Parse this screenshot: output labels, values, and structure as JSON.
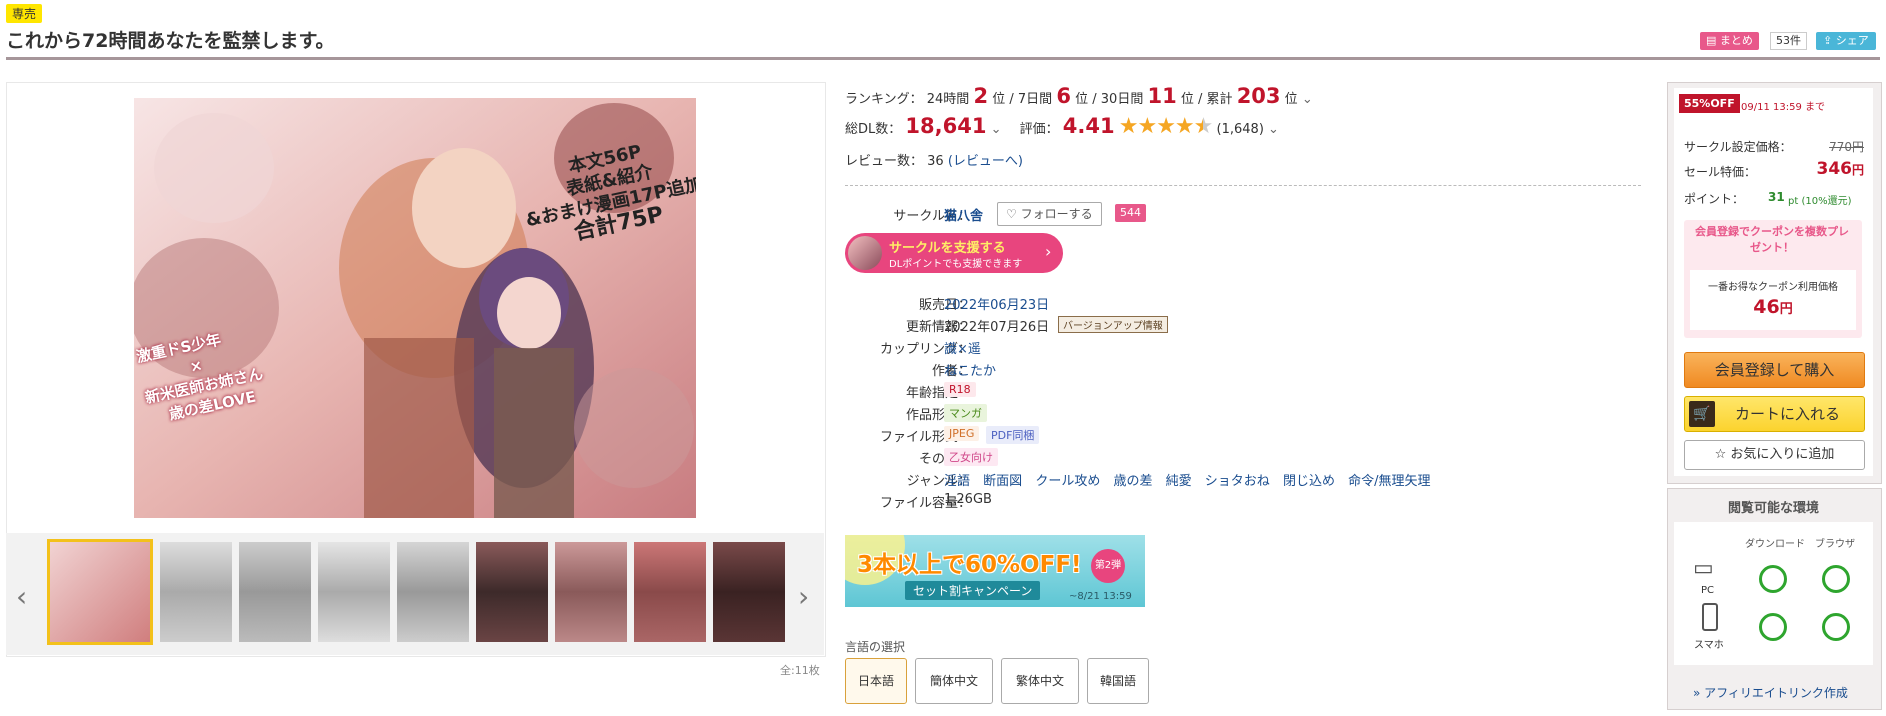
{
  "header": {
    "exclusive_label": "専売",
    "title": "これから72時間あなたを監禁します。",
    "matome_label": "まとめ",
    "matome_count": "53件",
    "share_label": "シェア"
  },
  "gallery": {
    "image_count": "全:11枚",
    "cover_caption_1": "本文56P",
    "cover_caption_2": "表紙&紹介",
    "cover_caption_3": "&おまけ漫画17P追加",
    "cover_caption_4": "合計75P",
    "cover_logo_text": "これから72時間あなたを監禁します。",
    "cover_tagline_1": "激重ドS少年",
    "cover_tagline_2": "×",
    "cover_tagline_3": "新米医師お姉さん",
    "cover_tagline_4": "歳の差LOVE"
  },
  "ranking": {
    "label": "ランキング：",
    "h24_label": "24時間",
    "h24_value": "2",
    "d7_label": "7日間",
    "d7_value": "6",
    "d30_label": "30日間",
    "d30_value": "11",
    "total_label": "累計",
    "total_value": "203",
    "unit": "位",
    "sep": "/"
  },
  "downloads": {
    "label": "総DL数：",
    "value": "18,641",
    "rating_label": "評価：",
    "rating_value": "4.41",
    "rating_stars": 4.41,
    "rating_count": "(1,648)"
  },
  "reviews": {
    "label": "レビュー数：",
    "value": "36",
    "link": "(レビューへ)"
  },
  "circle": {
    "label": "サークル名：",
    "name": "猫八舎",
    "follow_label": "フォローする",
    "follow_count": "544",
    "support_title": "サークルを支援する",
    "support_sub": "DLポイントでも支援できます"
  },
  "details": [
    {
      "label": "販売日：",
      "value": "2022年06月23日"
    },
    {
      "label": "更新情報：",
      "value": "2022年07月26日",
      "badge": "バージョンアップ情報"
    },
    {
      "label": "カップリング：",
      "value": "識×遥"
    },
    {
      "label": "作者：",
      "value": "ねこたか"
    },
    {
      "label": "年齢指定：",
      "value": "R18"
    },
    {
      "label": "作品形式：",
      "value": "マンガ"
    },
    {
      "label": "ファイル形式：",
      "value": "JPEG",
      "value2": "PDF同梱"
    },
    {
      "label": "その他：",
      "value": "乙女向け"
    },
    {
      "label": "ジャンル：",
      "genres": [
        "淫語",
        "断面図",
        "クール攻め",
        "歳の差",
        "純愛",
        "ショタおね",
        "閉じ込め",
        "命令/無理矢理"
      ]
    },
    {
      "label": "ファイル容量：",
      "value": "1.26GB"
    }
  ],
  "campaign": {
    "headline": "3本以上で60%OFF!",
    "badge": "第2弾",
    "sub": "セット割キャンペーン",
    "deadline": "~8/21 13:59"
  },
  "language": {
    "label": "言語の選択",
    "options": [
      "日本語",
      "簡体中文",
      "繁体中文",
      "韓国語"
    ]
  },
  "sidebar": {
    "off_badge": "55%OFF",
    "off_deadline": "09/11 13:59 まで",
    "circle_price_label": "サークル設定価格：",
    "circle_price": "770円",
    "sale_price_label": "セール特価：",
    "sale_price": "346",
    "sale_price_unit": "円",
    "point_label": "ポイント：",
    "point_value": "31",
    "point_unit": "pt (10%還元)",
    "coupon_promo": "会員登録でクーポンを複数プレゼント！",
    "coupon_best_label": "一番お得なクーポン利用価格",
    "coupon_price": "46",
    "coupon_price_unit": "円",
    "register_button": "会員登録して購入",
    "cart_button": "カートに入れる",
    "fav_button": "お気に入りに追加",
    "env_title": "閲覧可能な環境",
    "env_download": "ダウンロード",
    "env_browser": "ブラウザ",
    "env_pc": "PC",
    "env_phone": "スマホ",
    "affiliate_link": "» アフィリエイトリンク作成"
  },
  "colors": {
    "accent_red": "#c0142b",
    "badge_yellow": "#ffe600",
    "pink": "#e8588a",
    "link_blue": "#1a4d8f"
  }
}
